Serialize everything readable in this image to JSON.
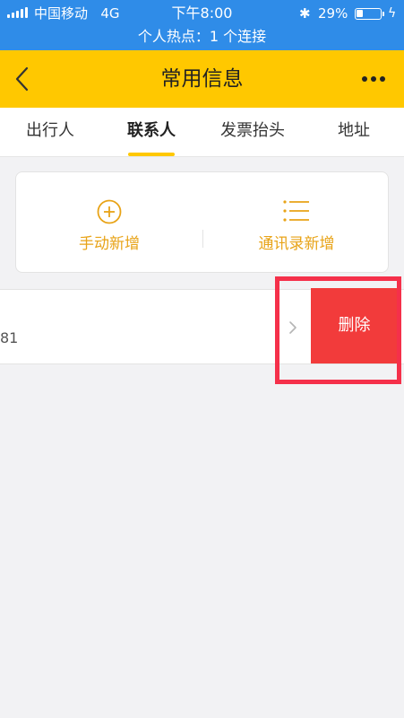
{
  "status_bar": {
    "carrier": "中国移动",
    "network": "4G",
    "time": "下午8:00",
    "bluetooth_icon": "bluetooth-icon",
    "battery_percent": "29%",
    "battery_level": 0.29,
    "hotspot": "个人热点：1 个连接",
    "bg_color": "#2f8ce8"
  },
  "navbar": {
    "title": "常用信息",
    "back_icon": "chevron-left-icon",
    "more_icon": "more-dots-icon",
    "bg_color": "#ffc800"
  },
  "tabs": [
    {
      "label": "出行人",
      "active": false
    },
    {
      "label": "联系人",
      "active": true
    },
    {
      "label": "发票抬头",
      "active": false
    },
    {
      "label": "地址",
      "active": false
    }
  ],
  "add_card": {
    "manual_add": {
      "label": "手动新增",
      "icon": "plus-circle-icon"
    },
    "contacts_add": {
      "label": "通讯录新增",
      "icon": "list-icon"
    },
    "accent_color": "#e8a317"
  },
  "contact_row": {
    "phone_suffix": "81",
    "chevron_icon": "chevron-right-icon",
    "delete_label": "删除",
    "delete_color": "#f23b3b"
  },
  "annotation": {
    "highlight_color": "#f5304a"
  }
}
